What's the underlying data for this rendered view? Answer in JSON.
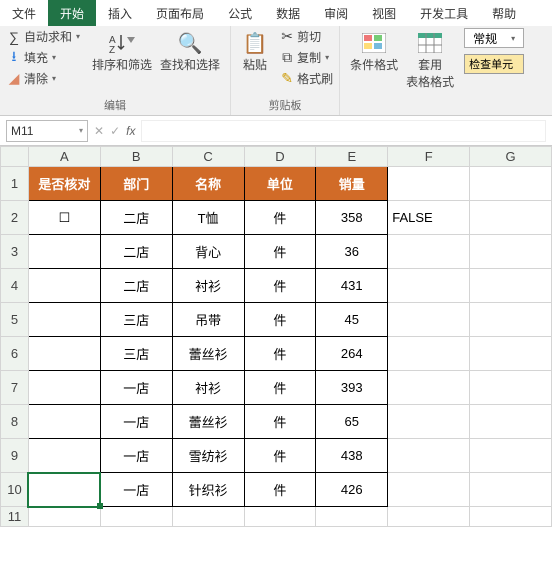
{
  "tabs": {
    "file": "文件",
    "home": "开始",
    "insert": "插入",
    "layout": "页面布局",
    "formula": "公式",
    "data": "数据",
    "review": "审阅",
    "view": "视图",
    "dev": "开发工具",
    "help": "帮助"
  },
  "ribbon": {
    "edit": {
      "autosum": "自动求和",
      "fill": "填充",
      "clear": "清除",
      "sort": "排序和筛选",
      "find": "查找和选择",
      "label": "编辑"
    },
    "clip": {
      "paste": "粘贴",
      "cut": "剪切",
      "copy": "复制",
      "fmtpaint": "格式刷",
      "label": "剪贴板"
    },
    "style": {
      "cond": "条件格式",
      "tbl1": "套用",
      "tbl2": "表格格式",
      "cellcheck": "检查单元"
    },
    "numfmt": "常规"
  },
  "namebox": "M11",
  "cols": [
    "A",
    "B",
    "C",
    "D",
    "E",
    "F",
    "G"
  ],
  "headers": {
    "check": "是否核对",
    "dept": "部门",
    "name": "名称",
    "unit": "单位",
    "qty": "销量"
  },
  "rows": [
    {
      "check": "☐",
      "dept": "二店",
      "name": "T恤",
      "unit": "件",
      "qty": "358"
    },
    {
      "check": "",
      "dept": "二店",
      "name": "背心",
      "unit": "件",
      "qty": "36"
    },
    {
      "check": "",
      "dept": "二店",
      "name": "衬衫",
      "unit": "件",
      "qty": "431"
    },
    {
      "check": "",
      "dept": "三店",
      "name": "吊带",
      "unit": "件",
      "qty": "45"
    },
    {
      "check": "",
      "dept": "三店",
      "name": "蕾丝衫",
      "unit": "件",
      "qty": "264"
    },
    {
      "check": "",
      "dept": "一店",
      "name": "衬衫",
      "unit": "件",
      "qty": "393"
    },
    {
      "check": "",
      "dept": "一店",
      "name": "蕾丝衫",
      "unit": "件",
      "qty": "65"
    },
    {
      "check": "",
      "dept": "一店",
      "name": "雪纺衫",
      "unit": "件",
      "qty": "438"
    },
    {
      "check": "",
      "dept": "一店",
      "name": "针织衫",
      "unit": "件",
      "qty": "426"
    }
  ],
  "f2": "FALSE"
}
